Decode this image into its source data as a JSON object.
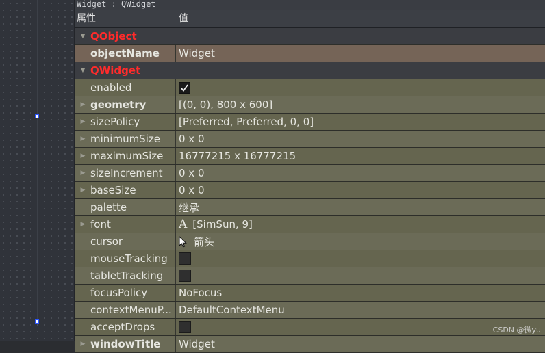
{
  "window": {
    "title": "Widget : QWidget"
  },
  "header": {
    "property_label": "属性",
    "value_label": "值"
  },
  "rows": [
    {
      "type": "group",
      "name": "QObject",
      "expanded": true
    },
    {
      "type": "prop",
      "name": "objectName",
      "bold": true,
      "value": "Widget",
      "highlight": true,
      "expandable": false
    },
    {
      "type": "group",
      "name": "QWidget",
      "expanded": true
    },
    {
      "type": "prop",
      "name": "enabled",
      "bold": false,
      "value_kind": "checkbox",
      "checked": true,
      "expandable": false
    },
    {
      "type": "prop",
      "name": "geometry",
      "bold": true,
      "value": "[(0, 0), 800 x 600]",
      "expandable": true
    },
    {
      "type": "prop",
      "name": "sizePolicy",
      "bold": false,
      "value": "[Preferred, Preferred, 0, 0]",
      "expandable": true
    },
    {
      "type": "prop",
      "name": "minimumSize",
      "bold": false,
      "value": "0 x 0",
      "expandable": true
    },
    {
      "type": "prop",
      "name": "maximumSize",
      "bold": false,
      "value": "16777215 x 16777215",
      "expandable": true
    },
    {
      "type": "prop",
      "name": "sizeIncrement",
      "bold": false,
      "value": "0 x 0",
      "expandable": true
    },
    {
      "type": "prop",
      "name": "baseSize",
      "bold": false,
      "value": "0 x 0",
      "expandable": true
    },
    {
      "type": "prop",
      "name": "palette",
      "bold": false,
      "value": "继承",
      "expandable": false
    },
    {
      "type": "prop",
      "name": "font",
      "bold": false,
      "value": "[SimSun, 9]",
      "icon": "font-icon",
      "icon_text": "A",
      "expandable": true
    },
    {
      "type": "prop",
      "name": "cursor",
      "bold": false,
      "value": "箭头",
      "icon": "arrow-cursor-icon",
      "expandable": false
    },
    {
      "type": "prop",
      "name": "mouseTracking",
      "bold": false,
      "value_kind": "checkbox",
      "checked": false,
      "expandable": false
    },
    {
      "type": "prop",
      "name": "tabletTracking",
      "bold": false,
      "value_kind": "checkbox",
      "checked": false,
      "expandable": false
    },
    {
      "type": "prop",
      "name": "focusPolicy",
      "bold": false,
      "value": "NoFocus",
      "expandable": false
    },
    {
      "type": "prop",
      "name": "contextMenuP...",
      "bold": false,
      "value": "DefaultContextMenu",
      "expandable": false
    },
    {
      "type": "prop",
      "name": "acceptDrops",
      "bold": false,
      "value_kind": "checkbox",
      "checked": false,
      "expandable": false
    },
    {
      "type": "prop",
      "name": "windowTitle",
      "bold": true,
      "value": "Widget",
      "expandable": true
    }
  ],
  "watermark": "CSDN @微yu",
  "colors": {
    "group_text": "#ff2b2b",
    "row_bg": "#6b6b57",
    "highlight_bg": "#756457",
    "selection_handle": "#2a55ff"
  }
}
